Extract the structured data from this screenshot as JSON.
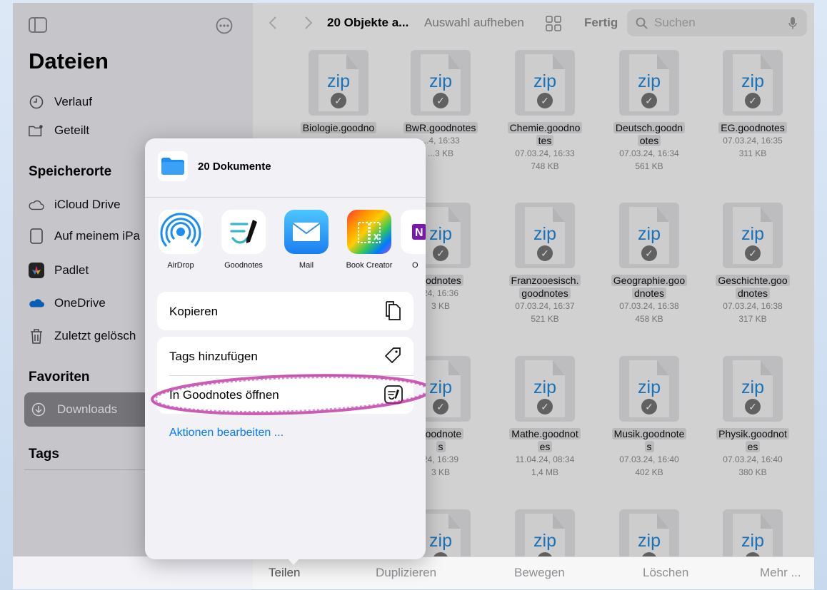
{
  "sidebar": {
    "title": "Dateien",
    "top_items": [
      {
        "label": "Verlauf",
        "icon": "clock-icon"
      },
      {
        "label": "Geteilt",
        "icon": "shared-folder-icon"
      }
    ],
    "locations_heading": "Speicherorte",
    "locations": [
      {
        "label": "iCloud Drive",
        "icon": "cloud-icon"
      },
      {
        "label": "Auf meinem iPa",
        "icon": "ipad-icon"
      },
      {
        "label": "Padlet",
        "icon": "padlet-icon"
      },
      {
        "label": "OneDrive",
        "icon": "onedrive-icon"
      },
      {
        "label": "Zuletzt gelösch",
        "icon": "trash-icon"
      }
    ],
    "favorites_heading": "Favoriten",
    "downloads_label": "Downloads",
    "tags_heading": "Tags"
  },
  "toolbar": {
    "title": "20 Objekte a...",
    "deselect_label": "Auswahl aufheben",
    "done_label": "Fertig",
    "search_placeholder": "Suchen"
  },
  "files": [
    {
      "name1": "Biologie.goodno",
      "name2": "",
      "date": "",
      "size": ""
    },
    {
      "name1": "BwR.goodnotes",
      "name2": "",
      "date": "...4, 16:33",
      "size": "...3 KB"
    },
    {
      "name1": "Chemie.goodno",
      "name2": "tes",
      "date": "07.03.24, 16:33",
      "size": "748 KB"
    },
    {
      "name1": "Deutsch.goodn",
      "name2": "otes",
      "date": "07.03.24, 16:34",
      "size": "561 KB"
    },
    {
      "name1": "EG.goodnotes",
      "name2": "",
      "date": "07.03.24, 16:35",
      "size": "311 KB"
    },
    {
      "name1": "",
      "name2": "",
      "date": "",
      "size": ""
    },
    {
      "name1": "oodnotes",
      "name2": "",
      "date": "24, 16:36",
      "size": "3 KB"
    },
    {
      "name1": "Franzooesisch.",
      "name2": "goodnotes",
      "date": "07.03.24, 16:37",
      "size": "521 KB"
    },
    {
      "name1": "Geographie.goo",
      "name2": "dnotes",
      "date": "07.03.24, 16:38",
      "size": "458 KB"
    },
    {
      "name1": "Geschichte.goo",
      "name2": "dnotes",
      "date": "07.03.24, 16:38",
      "size": "317 KB"
    },
    {
      "name1": "",
      "name2": "",
      "date": "",
      "size": ""
    },
    {
      "name1": "goodnote",
      "name2": "s",
      "date": "24, 16:39",
      "size": "3 KB"
    },
    {
      "name1": "Mathe.goodnot",
      "name2": "es",
      "date": "11.04.24, 08:34",
      "size": "1,4 MB"
    },
    {
      "name1": "Musik.goodnote",
      "name2": "s",
      "date": "07.03.24, 16:40",
      "size": "402 KB"
    },
    {
      "name1": "Physik.goodnot",
      "name2": "es",
      "date": "07.03.24, 16:40",
      "size": "380 KB"
    }
  ],
  "zip_label": "zip",
  "bottombar": {
    "share": "Teilen",
    "duplicate": "Duplizieren",
    "move": "Bewegen",
    "delete": "Löschen",
    "more": "Mehr ..."
  },
  "share_sheet": {
    "header_title": "20 Dokumente",
    "apps": [
      {
        "label": "AirDrop",
        "icon": "airdrop-icon"
      },
      {
        "label": "Goodnotes",
        "icon": "goodnotes-icon"
      },
      {
        "label": "Mail",
        "icon": "mail-icon"
      },
      {
        "label": "Book Creator",
        "icon": "book-creator-icon"
      },
      {
        "label": "O",
        "icon": "onenote-icon"
      }
    ],
    "copy_label": "Kopieren",
    "add_tags_label": "Tags hinzufügen",
    "open_in_goodnotes_label": "In Goodnotes öffnen",
    "edit_actions_label": "Aktionen bearbeiten ..."
  },
  "colors": {
    "accent": "#007aff",
    "zip_blue": "#1f8ce0",
    "highlight_circle": "#b8269e"
  }
}
